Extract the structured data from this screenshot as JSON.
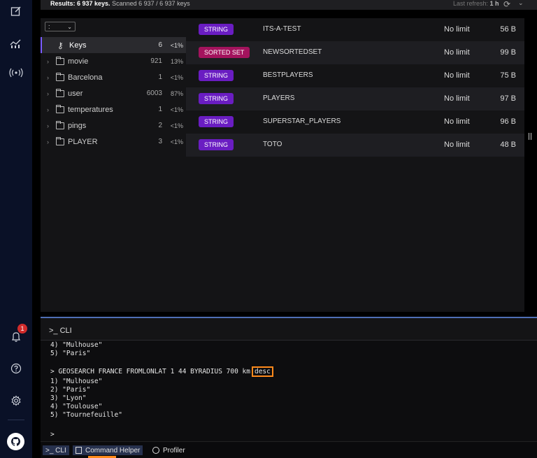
{
  "nav": {
    "notification_count": "1",
    "icons": [
      "edit-icon",
      "analysis-icon",
      "pubsub-icon",
      "bell-icon",
      "help-icon",
      "settings-icon",
      "github-icon"
    ]
  },
  "browser": {
    "results_label": "Results: 6 937 keys.",
    "scanned_label": "Scanned 6 937 / 6 937 keys",
    "refresh_label": "Last refresh:",
    "refresh_value": "1 h",
    "delimiter": ":",
    "tree": [
      {
        "name": "Keys",
        "count": "6",
        "pct": "<1%"
      },
      {
        "name": "movie",
        "count": "921",
        "pct": "13%"
      },
      {
        "name": "Barcelona",
        "count": "1",
        "pct": "<1%"
      },
      {
        "name": "user",
        "count": "6003",
        "pct": "87%"
      },
      {
        "name": "temperatures",
        "count": "1",
        "pct": "<1%"
      },
      {
        "name": "pings",
        "count": "2",
        "pct": "<1%"
      },
      {
        "name": "PLAYER",
        "count": "3",
        "pct": "<1%"
      }
    ],
    "keys": [
      {
        "type": "STRING",
        "name": "ITS-A-TEST",
        "ttl": "No limit",
        "size": "56 B"
      },
      {
        "type": "SORTED SET",
        "name": "NEWSORTEDSET",
        "ttl": "No limit",
        "size": "99 B"
      },
      {
        "type": "STRING",
        "name": "BESTPLAYERS",
        "ttl": "No limit",
        "size": "75 B"
      },
      {
        "type": "STRING",
        "name": "PLAYERS",
        "ttl": "No limit",
        "size": "97 B"
      },
      {
        "type": "STRING",
        "name": "SUPERSTAR_PLAYERS",
        "ttl": "No limit",
        "size": "96 B"
      },
      {
        "type": "STRING",
        "name": "TOTO",
        "ttl": "No limit",
        "size": "48 B"
      }
    ],
    "colors": {
      "string": "#6a1dc2",
      "sorted_set": "#a3135d"
    }
  },
  "cli": {
    "title": ">_ CLI",
    "lines": [
      "4) \"Mulhouse\"",
      "5) \"Paris\"",
      "",
      "> GEOSEARCH FRANCE FROMLONLAT 1 44 BYRADIUS 700 km",
      "1) \"Mulhouse\"",
      "2) \"Paris\"",
      "3) \"Lyon\"",
      "4) \"Toulouse\"",
      "5) \"Tournefeuille\"",
      "",
      ">"
    ],
    "highlight": "desc"
  },
  "bottom_bar": {
    "cli": ">_ CLI",
    "helper": "Command Helper",
    "profiler": "Profiler"
  }
}
